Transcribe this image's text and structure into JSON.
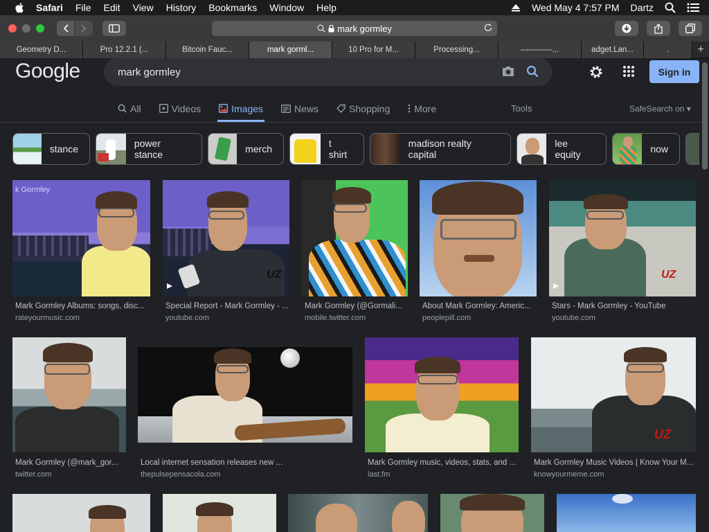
{
  "menubar": {
    "app": "Safari",
    "items": [
      "File",
      "Edit",
      "View",
      "History",
      "Bookmarks",
      "Window",
      "Help"
    ],
    "datetime": "Wed May 4  7:57 PM",
    "user": "Dartz"
  },
  "toolbar": {
    "url": "mark gormley"
  },
  "tabs": [
    "Geometry D...",
    "Pro 12.2.1 (...",
    "Bitcoin Fauc...",
    "mark gorml...",
    "10 Pro for M...",
    "Processing...",
    "------------...",
    "adget.Lan...",
    "."
  ],
  "google": {
    "logo": "Google",
    "query": "mark gormley",
    "signin": "Sign in",
    "tabs": [
      "All",
      "Videos",
      "Images",
      "News",
      "Shopping",
      "More"
    ],
    "tools": "Tools",
    "safesearch": "SafeSearch on"
  },
  "chips": [
    "stance",
    "power stance",
    "merch",
    "t shirt",
    "madison realty capital",
    "lee equity",
    "now"
  ],
  "results": [
    {
      "title": "Mark Gormley Albums: songs, disc...",
      "source": "rateyourmusic.com",
      "overlay": "k Gormley"
    },
    {
      "title": "Special Report - Mark Gormley - ...",
      "source": "youtube.com",
      "overlay": "UZ"
    },
    {
      "title": "Mark Gormley (@Gormali...",
      "source": "mobile.twitter.com"
    },
    {
      "title": "About Mark Gormley: Americ...",
      "source": "peoplepill.com"
    },
    {
      "title": "Stars - Mark Gormley - YouTube",
      "source": "youtube.com",
      "overlay": "UZ"
    },
    {
      "title": "Mark Gormley (@mark_gor...",
      "source": "twitter.com"
    },
    {
      "title": "Local internet sensation releases new ...",
      "source": "thepulsepensacola.com"
    },
    {
      "title": "Mark Gormley music, videos, stats, and ...",
      "source": "last.fm"
    },
    {
      "title": "Mark Gormley Music Videos | Know Your M...",
      "source": "knowyourmeme.com",
      "overlay": "UZ"
    }
  ]
}
